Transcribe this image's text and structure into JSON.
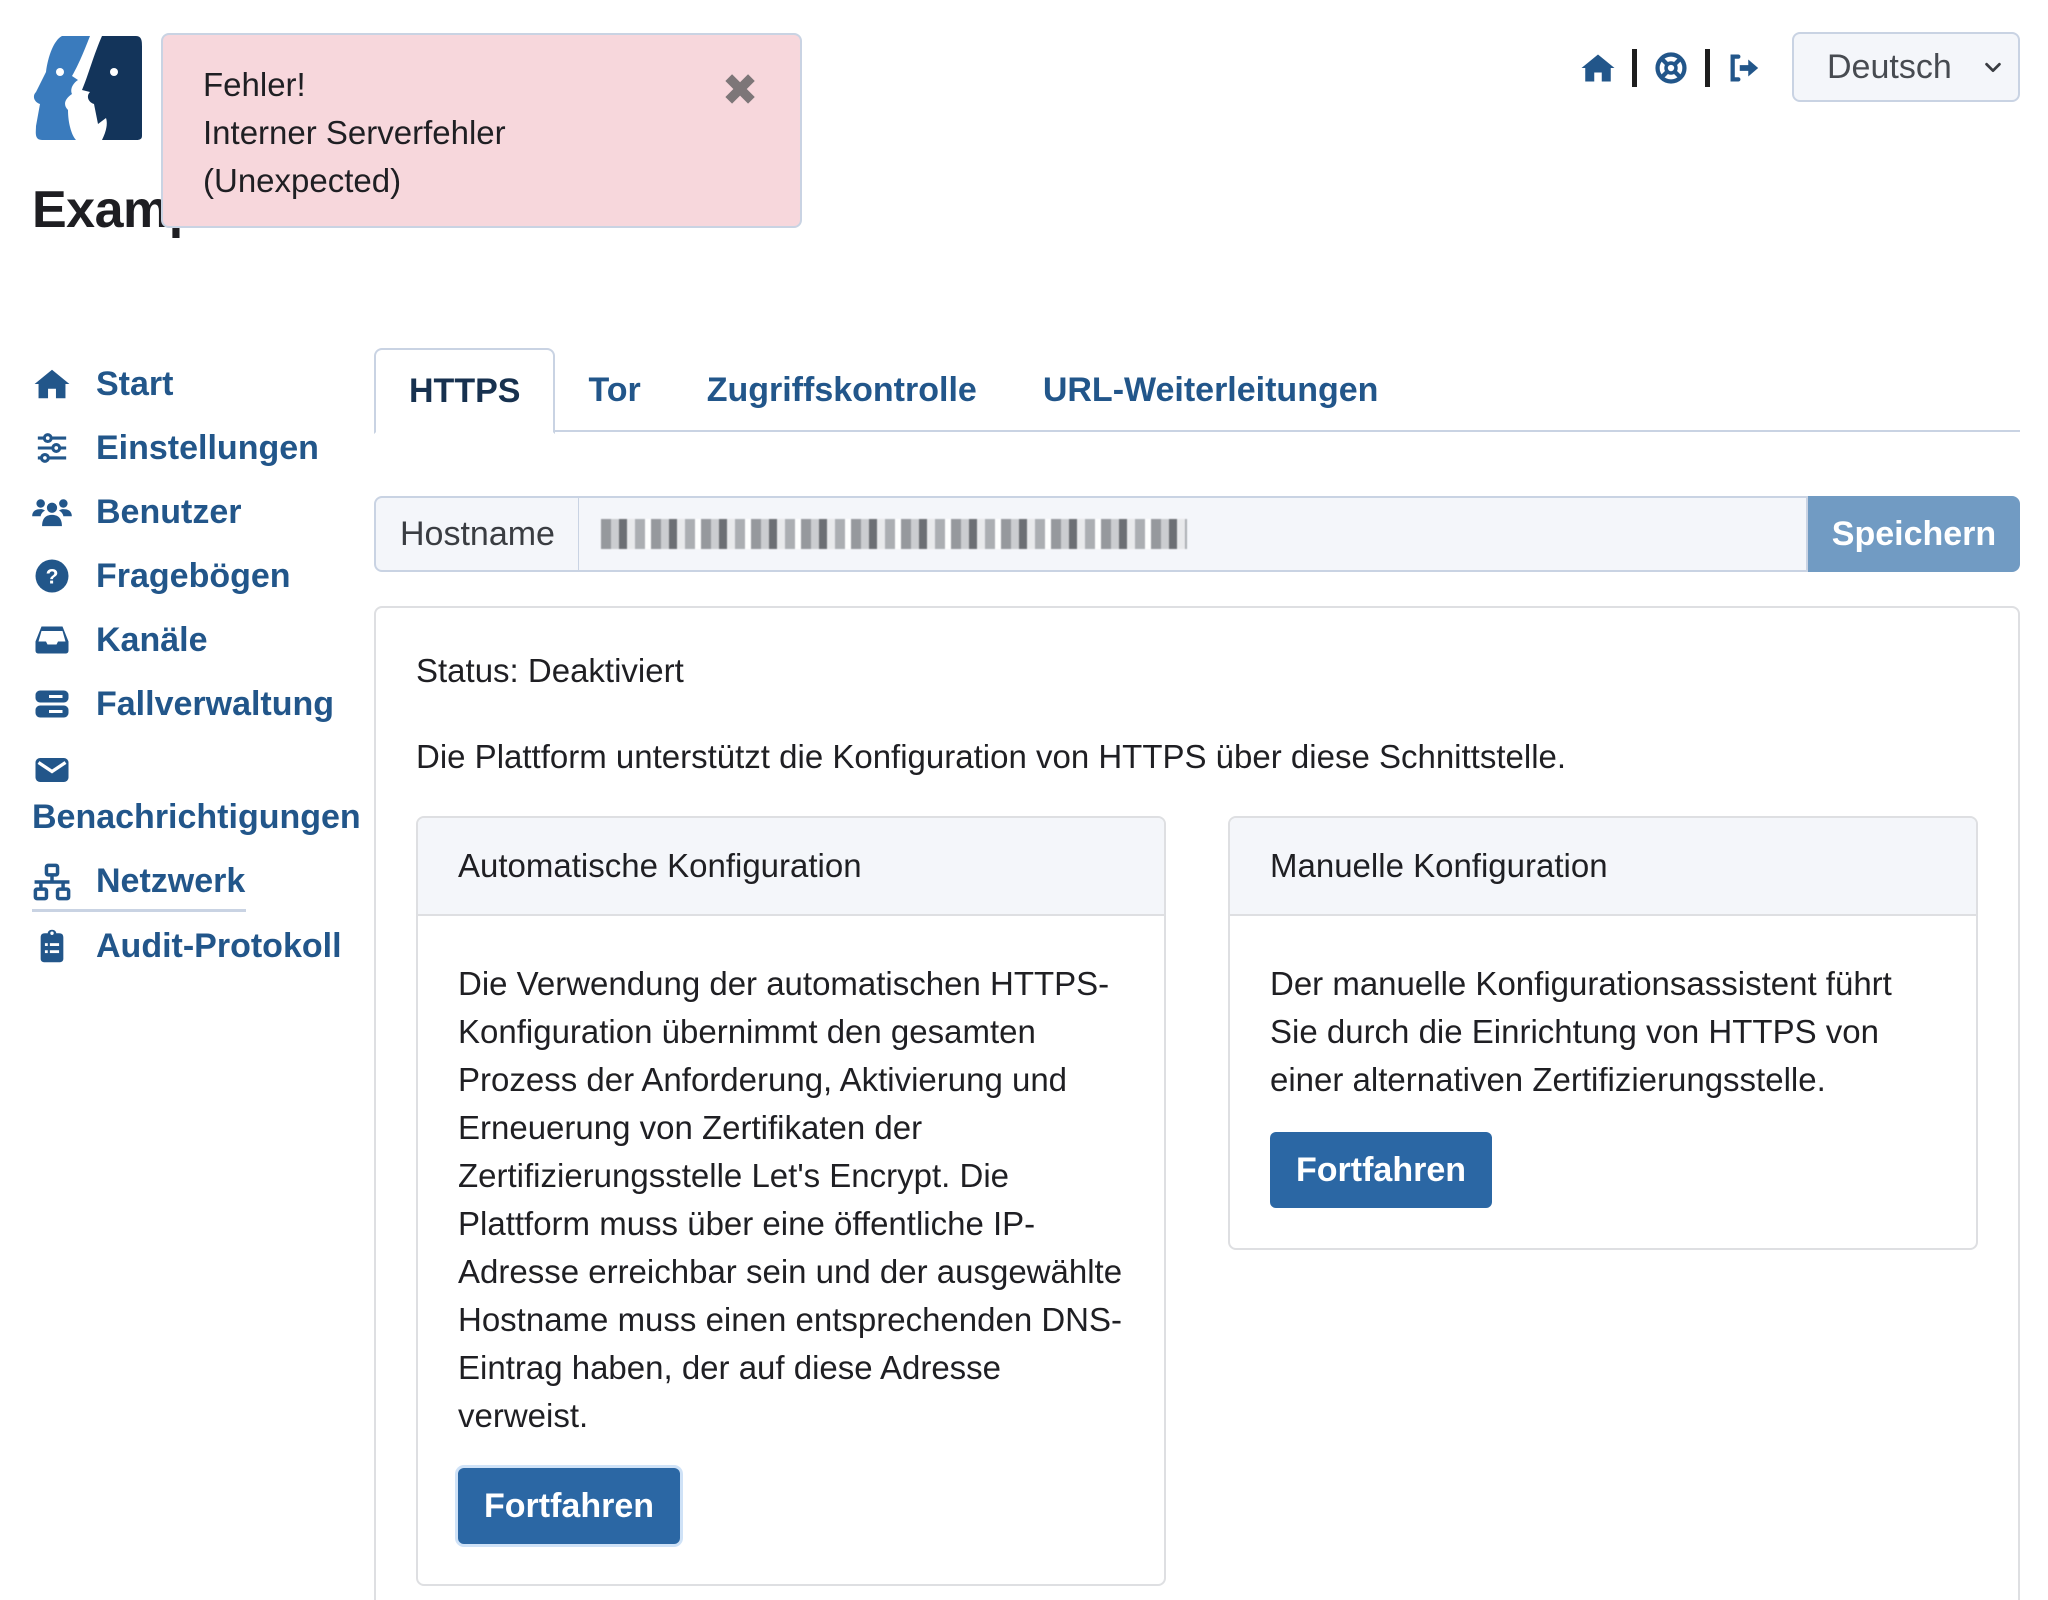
{
  "header": {
    "page_title": "Example - Netzwerk",
    "logo_colors": {
      "left_face": "#3a7bbd",
      "right_face": "#13345a"
    },
    "top_nav": [
      {
        "name": "home",
        "icon": "home-icon"
      },
      {
        "name": "support",
        "icon": "lifebuoy-icon"
      },
      {
        "name": "logout",
        "icon": "sign-out-icon"
      }
    ],
    "language_select": {
      "value": "Deutsch"
    }
  },
  "alert": {
    "title": "Fehler!",
    "message_line1": "Interner Serverfehler",
    "message_line2": "(Unexpected)",
    "close_symbol": "✖"
  },
  "sidebar": {
    "items": [
      {
        "label": "Start",
        "icon": "home-icon"
      },
      {
        "label": "Einstellungen",
        "icon": "sliders-icon"
      },
      {
        "label": "Benutzer",
        "icon": "users-icon"
      },
      {
        "label": "Fragebögen",
        "icon": "question-circle-icon"
      },
      {
        "label": "Kanäle",
        "icon": "inbox-icon"
      },
      {
        "label": "Fallverwaltung",
        "icon": "server-icon"
      },
      {
        "label": "Benachrichtigungen",
        "icon": "envelope-icon"
      },
      {
        "label": "Netzwerk",
        "icon": "network-icon",
        "active": true
      },
      {
        "label": "Audit-Protokoll",
        "icon": "clipboard-list-icon"
      }
    ]
  },
  "tabs": [
    {
      "label": "HTTPS",
      "active": true
    },
    {
      "label": "Tor"
    },
    {
      "label": "Zugriffskontrolle"
    },
    {
      "label": "URL-Weiterleitungen"
    }
  ],
  "hostname": {
    "label": "Hostname",
    "value_redacted": true,
    "save_label": "Speichern"
  },
  "https": {
    "status": "Status: Deaktiviert",
    "intro": "Die Plattform unterstützt die Konfiguration von HTTPS über diese Schnittstelle.",
    "auto_card": {
      "title": "Automatische Konfiguration",
      "text": "Die Verwendung der automatischen HTTPS-Konfiguration übernimmt den gesamten Prozess der Anforderung, Aktivierung und Erneuerung von Zertifikaten der Zertifizierungsstelle Let's Encrypt. Die Plattform muss über eine öffentliche IP-Adresse erreichbar sein und der ausgewählte Hostname muss einen entsprechenden DNS-Eintrag haben, der auf diese Adresse verweist.",
      "button": "Fortfahren"
    },
    "manual_card": {
      "title": "Manuelle Konfiguration",
      "text": "Der manuelle Konfigurationsassistent führt Sie durch die Einrichtung von HTTPS von einer alternativen Zertifizierungsstelle.",
      "button": "Fortfahren"
    }
  },
  "colors": {
    "primary": "#2b67a4",
    "link": "#22568a",
    "save_disabled": "#719bc3",
    "alert_bg": "#f7d7dc"
  }
}
